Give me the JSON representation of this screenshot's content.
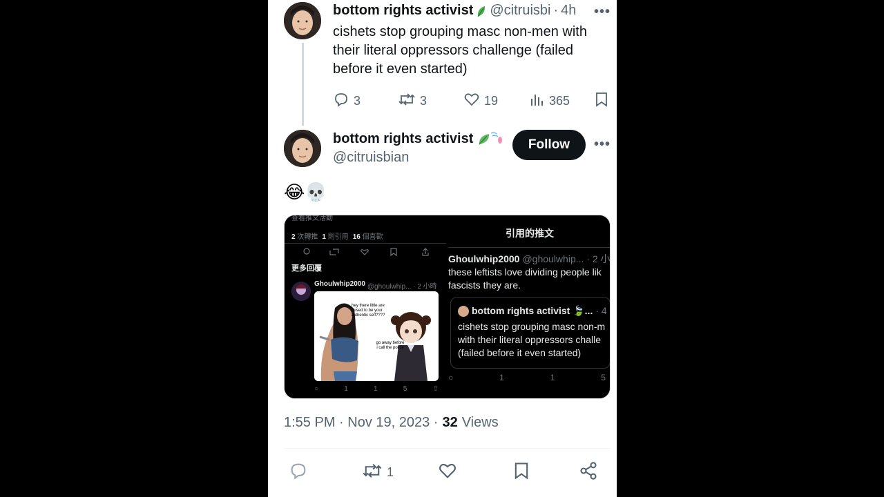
{
  "parent_tweet": {
    "author_name": "bottom rights activist",
    "handle": "@citruisbi",
    "time": "4h",
    "more": "•••",
    "text_lines": [
      "cishets stop grouping masc non-men with",
      "their literal oppressors challenge (failed",
      "before it even started)"
    ],
    "replies": "3",
    "retweets": "3",
    "likes": "19",
    "views": "365"
  },
  "main_tweet": {
    "author_name": "bottom rights activist",
    "handle": "@citruisbian",
    "follow_label": "Follow",
    "more": "•••",
    "emoji_text": "😂💀",
    "timestamp": "1:55 PM · Nov 19, 2023 ·",
    "views_count": "32",
    "views_label": "Views",
    "retweets": "1"
  },
  "left_screenshot": {
    "top_cut": "查看推文活動",
    "stats": [
      {
        "count": "2",
        "label": "次轉推"
      },
      {
        "count": "1",
        "label": "則引用"
      },
      {
        "count": "16",
        "label": "個喜歡"
      }
    ],
    "more_replies": "更多回覆",
    "reply_name": "Ghoulwhip2000",
    "reply_handle": "@ghoulwhip... · 2 小時",
    "meme_caption_1": "hey there little are used to be your authentic self????",
    "meme_caption_2": "go away before i call the police",
    "bottom_stats": [
      "1",
      "1",
      "5"
    ]
  },
  "right_screenshot": {
    "header": "引用的推文",
    "quote_name": "Ghoulwhip2000",
    "quote_handle": "@ghoulwhip... · 2 小",
    "quote_lines": [
      "these leftists love dividing people lik",
      "fascists they are."
    ],
    "inner_name": "bottom rights activist 🍃...",
    "inner_time": "· 4",
    "inner_lines": [
      "cishets stop grouping masc non-m",
      "with their literal oppressors challe",
      "(failed before it even started)"
    ],
    "stats": [
      "1",
      "1",
      "5"
    ]
  }
}
